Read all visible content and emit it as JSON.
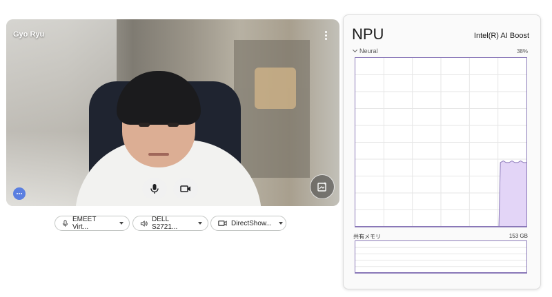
{
  "video": {
    "owner_name": "Gyo Ryu"
  },
  "devices": {
    "microphone": "EMEET Virt...",
    "speaker": "DELL S2721...",
    "camera": "DirectShow..."
  },
  "npu": {
    "title": "NPU",
    "device_name": "Intel(R) AI Boost",
    "engine_label": "Neural",
    "usage_percent": "38%",
    "shared_memory_label": "共有メモリ",
    "shared_memory_value": "153 GB",
    "accent_color": "#8a78b8",
    "fill_color": "#e3d5f7"
  },
  "chart_data": {
    "type": "area",
    "title": "Neural",
    "ylim": [
      0,
      100
    ],
    "x": [
      0,
      1,
      2,
      3,
      4,
      5,
      6,
      7,
      8,
      9,
      10,
      11,
      12,
      13,
      14,
      15,
      16,
      17,
      18,
      19,
      20,
      21,
      22,
      23,
      24,
      25,
      26,
      27,
      28,
      29,
      30,
      31,
      32,
      33,
      34,
      35,
      36,
      37,
      38,
      39,
      40,
      41,
      42,
      43,
      44,
      45,
      46,
      47,
      48,
      49,
      50,
      51,
      52,
      53,
      54,
      55,
      56,
      57,
      58,
      59
    ],
    "values": [
      0,
      0,
      0,
      0,
      0,
      0,
      0,
      0,
      0,
      0,
      0,
      0,
      0,
      0,
      0,
      0,
      0,
      0,
      0,
      0,
      0,
      0,
      0,
      0,
      0,
      0,
      0,
      0,
      0,
      0,
      0,
      0,
      0,
      0,
      0,
      0,
      0,
      0,
      0,
      0,
      0,
      0,
      0,
      0,
      0,
      0,
      0,
      0,
      0,
      0,
      38,
      39,
      38,
      38,
      39,
      38,
      38,
      39,
      38,
      38
    ],
    "grid": true
  },
  "memory_chart": {
    "type": "line",
    "ylim": [
      0,
      100
    ],
    "values": [
      0,
      0,
      0,
      0,
      0,
      0,
      0,
      0,
      0,
      0,
      0,
      0,
      0,
      0,
      0,
      0,
      0,
      0,
      0,
      0,
      0,
      0,
      0,
      0,
      0,
      0,
      0,
      0,
      0,
      0,
      0,
      0,
      0,
      0,
      0,
      0,
      0,
      0,
      0,
      0,
      0,
      0,
      0,
      0,
      0,
      0,
      0,
      0,
      0,
      0,
      0,
      0,
      0,
      0,
      0,
      0,
      0,
      0,
      0,
      0
    ]
  }
}
